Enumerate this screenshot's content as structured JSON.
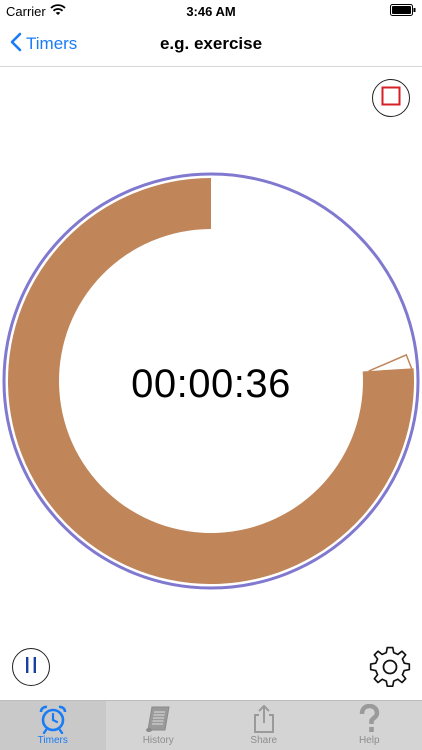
{
  "status_bar": {
    "carrier": "Carrier",
    "time": "3:46 AM"
  },
  "nav": {
    "back_label": "Timers",
    "title": "e.g. exercise"
  },
  "timer": {
    "display": "00:00:36",
    "ring_progress": 0.76
  },
  "colors": {
    "ring_outline": "#8079cf",
    "progress_fill": "#c08559",
    "accent": "#1a7cf5",
    "stop_red": "#d81f26"
  },
  "tabs": [
    {
      "label": "Timers",
      "icon": "alarm-clock-icon",
      "active": true
    },
    {
      "label": "History",
      "icon": "scroll-icon",
      "active": false
    },
    {
      "label": "Share",
      "icon": "share-icon",
      "active": false
    },
    {
      "label": "Help",
      "icon": "question-mark-icon",
      "active": false
    }
  ]
}
